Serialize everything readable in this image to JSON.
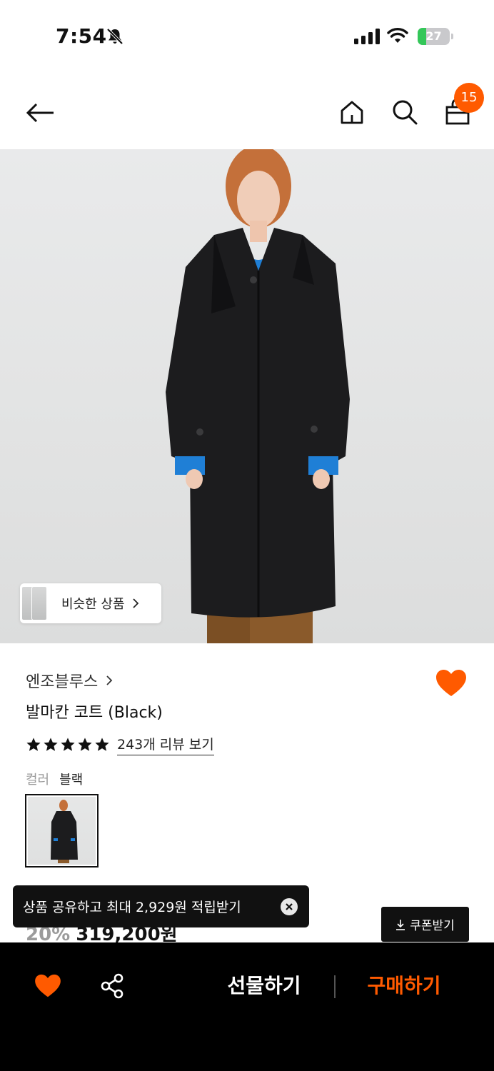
{
  "status_bar": {
    "time": "7:54",
    "battery_percent": 27,
    "battery_text": "27"
  },
  "header": {
    "cart_count": "15"
  },
  "image": {
    "similar_label": "비슷한 상품"
  },
  "product": {
    "brand": "엔조블루스",
    "title": "발마칸 코트 (Black)",
    "rating_stars": 5,
    "review_link": "243개 리뷰 보기",
    "color_label": "컬러",
    "color_value": "블랙",
    "discount": "20%",
    "price": "319,200원"
  },
  "toast": {
    "text": "상품 공유하고 최대 2,929원 적립받기"
  },
  "coupon": {
    "label": "쿠폰받기"
  },
  "bottom_bar": {
    "gift_label": "선물하기",
    "buy_label": "구매하기"
  },
  "colors": {
    "accent": "#ff5a00",
    "dark": "#111111",
    "battery_green": "#34c759"
  }
}
